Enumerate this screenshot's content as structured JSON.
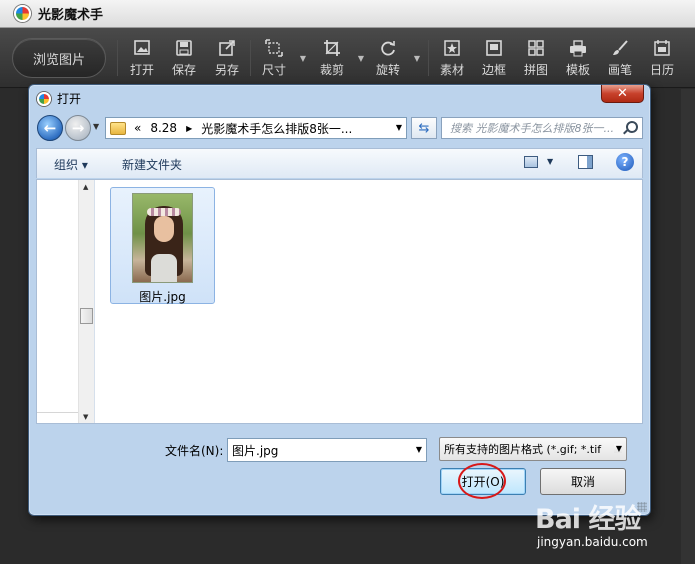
{
  "app": {
    "title": "光影魔术手",
    "browse_label": "浏览图片",
    "tools": [
      {
        "label": "打开",
        "icon": "image-open-icon"
      },
      {
        "label": "保存",
        "icon": "save-icon"
      },
      {
        "label": "另存",
        "icon": "save-as-icon"
      },
      {
        "label": "尺寸",
        "icon": "resize-icon"
      },
      {
        "label": "裁剪",
        "icon": "crop-icon"
      },
      {
        "label": "旋转",
        "icon": "rotate-icon"
      },
      {
        "label": "素材",
        "icon": "star-icon"
      },
      {
        "label": "边框",
        "icon": "frame-icon"
      },
      {
        "label": "拼图",
        "icon": "grid-icon"
      },
      {
        "label": "模板",
        "icon": "printer-icon"
      },
      {
        "label": "画笔",
        "icon": "brush-icon"
      },
      {
        "label": "日历",
        "icon": "calendar-icon"
      }
    ]
  },
  "dialog": {
    "title": "打开",
    "close_glyph": "✕",
    "address": {
      "prefix": "«",
      "segments": [
        "8.28",
        "光影魔术手怎么排版8张一..."
      ]
    },
    "search_placeholder": "搜索 光影魔术手怎么排版8张一...",
    "commands": {
      "organize": "组织 ▾",
      "new_folder": "新建文件夹",
      "help": "?"
    },
    "files": [
      {
        "name": "图片.jpg",
        "selected": true
      }
    ],
    "footer": {
      "filename_label": "文件名(N):",
      "filename_value": "图片.jpg",
      "filetype_value": "所有支持的图片格式 (*.gif; *.tif",
      "open_button": "打开(O)",
      "cancel_button": "取消"
    }
  },
  "watermark": {
    "brand": "Bai 经验",
    "url": "jingyan.baidu.com"
  },
  "colors": {
    "dialog_frame": "#bcd3ec",
    "toolbar_bg": "#3a3a3a",
    "highlight_ring": "#d81818",
    "selection": "#cfe2f8"
  }
}
